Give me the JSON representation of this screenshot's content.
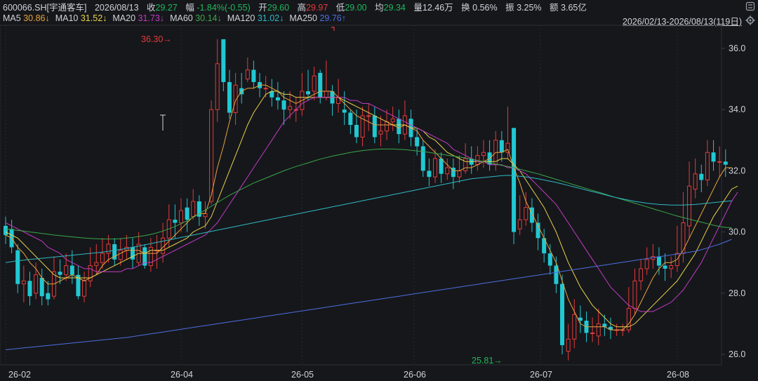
{
  "quote": {
    "symbol": "600066.SH[宇通客车]",
    "date": "2026/08/13",
    "close_label": "收",
    "close": "29.27",
    "change_label": "幅",
    "change": "-1.84%(-0.55)",
    "open_label": "开",
    "open": "29.60",
    "high_label": "高",
    "high": "29.97",
    "low_label": "低",
    "low": "29.00",
    "avg_label": "均",
    "avg": "29.34",
    "volume_label": "量",
    "volume": "12.46万",
    "turnover_label": "换",
    "turnover": "0.56%",
    "amplitude_label": "振",
    "amplitude": "3.25%",
    "amount_label": "额",
    "amount": "3.65亿"
  },
  "range_label": "2026/02/13-2026/08/13(119日)",
  "colors": {
    "background": "#16171b",
    "up": "#e23b3b",
    "down": "#21c8d2",
    "grid": "#262a31",
    "text": "#cfd3da",
    "green_text": "#1fb85a",
    "red_text": "#e23b3b"
  },
  "chart_data": {
    "type": "candlestick",
    "x_ticks": [
      "26-02",
      "26-04",
      "26-05",
      "26-06",
      "26-07",
      "26-08"
    ],
    "y_ticks": [
      "26.0",
      "28.0",
      "30.0",
      "32.0",
      "34.0",
      "36.0"
    ],
    "ylim": [
      25.6,
      36.7
    ],
    "max_marker": {
      "label": "36.30",
      "value": 36.3
    },
    "min_marker": {
      "label": "25.81",
      "value": 25.81
    },
    "ma_legend": [
      {
        "name": "MA5",
        "value": "30.86",
        "arrow": "↓",
        "color": "#e8a33c"
      },
      {
        "name": "MA10",
        "value": "31.52",
        "arrow": "↓",
        "color": "#e6d24a"
      },
      {
        "name": "MA20",
        "value": "31.73",
        "arrow": "↓",
        "color": "#c13cc3"
      },
      {
        "name": "MA60",
        "value": "30.14",
        "arrow": "↓",
        "color": "#3aa64a"
      },
      {
        "name": "MA120",
        "value": "31.02",
        "arrow": "↓",
        "color": "#2fb8c4"
      },
      {
        "name": "MA250",
        "value": "29.76",
        "arrow": "↑",
        "color": "#4a6fe0"
      }
    ],
    "candles": [
      [
        30.2,
        29.9,
        30.5,
        29.6
      ],
      [
        30.1,
        29.5,
        30.4,
        29.3
      ],
      [
        29.4,
        28.3,
        29.6,
        28.0
      ],
      [
        28.3,
        28.4,
        28.9,
        27.7
      ],
      [
        28.4,
        27.9,
        28.7,
        27.6
      ],
      [
        28.0,
        28.6,
        29.0,
        27.8
      ],
      [
        28.5,
        27.9,
        28.8,
        27.6
      ],
      [
        28.0,
        27.8,
        28.4,
        27.6
      ],
      [
        27.9,
        28.7,
        29.2,
        27.8
      ],
      [
        28.7,
        28.6,
        29.1,
        28.3
      ],
      [
        28.6,
        28.9,
        29.3,
        28.4
      ],
      [
        28.9,
        28.6,
        29.4,
        28.3
      ],
      [
        28.6,
        27.9,
        28.9,
        27.8
      ],
      [
        27.9,
        28.4,
        28.7,
        27.7
      ],
      [
        28.4,
        28.9,
        29.5,
        28.2
      ],
      [
        28.9,
        29.0,
        29.6,
        28.6
      ],
      [
        29.0,
        29.3,
        29.8,
        28.8
      ],
      [
        29.3,
        29.6,
        29.9,
        29.0
      ],
      [
        29.6,
        29.1,
        29.8,
        28.9
      ],
      [
        29.1,
        29.4,
        29.8,
        28.9
      ],
      [
        29.4,
        29.5,
        29.9,
        29.1
      ],
      [
        29.5,
        29.1,
        29.8,
        28.8
      ],
      [
        29.0,
        29.6,
        30.0,
        28.9
      ],
      [
        29.5,
        28.9,
        29.6,
        28.8
      ],
      [
        28.9,
        29.5,
        29.8,
        28.7
      ],
      [
        29.4,
        29.4,
        29.9,
        28.8
      ],
      [
        29.3,
        29.8,
        30.3,
        29.0
      ],
      [
        29.8,
        30.4,
        30.9,
        29.5
      ],
      [
        30.4,
        30.3,
        30.9,
        29.8
      ],
      [
        30.3,
        30.7,
        31.1,
        30.0
      ],
      [
        30.8,
        30.4,
        31.1,
        30.0
      ],
      [
        30.5,
        31.0,
        31.4,
        30.4
      ],
      [
        31.0,
        30.5,
        31.2,
        30.2
      ],
      [
        30.5,
        30.6,
        31.0,
        30.1
      ],
      [
        31.0,
        34.0,
        34.3,
        30.9
      ],
      [
        34.0,
        35.5,
        36.3,
        33.6
      ],
      [
        36.3,
        34.9,
        36.3,
        34.6
      ],
      [
        34.9,
        33.9,
        35.3,
        33.7
      ],
      [
        33.9,
        34.8,
        35.2,
        33.5
      ],
      [
        34.7,
        34.5,
        35.2,
        34.2
      ],
      [
        35.0,
        35.3,
        35.7,
        34.9
      ],
      [
        35.3,
        34.9,
        35.6,
        34.7
      ],
      [
        34.9,
        34.7,
        35.2,
        34.4
      ],
      [
        34.7,
        34.7,
        35.1,
        34.4
      ],
      [
        34.6,
        34.4,
        35.0,
        34.1
      ],
      [
        34.4,
        34.3,
        34.9,
        34.0
      ],
      [
        34.3,
        34.0,
        34.6,
        33.5
      ],
      [
        34.0,
        34.1,
        34.6,
        33.7
      ],
      [
        34.0,
        34.0,
        34.4,
        33.6
      ],
      [
        34.0,
        34.6,
        35.2,
        33.8
      ],
      [
        34.6,
        34.5,
        35.3,
        34.3
      ],
      [
        34.6,
        35.1,
        35.4,
        34.3
      ],
      [
        35.2,
        34.4,
        35.3,
        34.2
      ],
      [
        34.4,
        34.6,
        35.6,
        34.3
      ],
      [
        34.6,
        34.2,
        34.8,
        33.8
      ],
      [
        34.2,
        34.4,
        35.0,
        33.9
      ],
      [
        34.0,
        33.9,
        34.6,
        33.5
      ],
      [
        33.9,
        33.5,
        34.0,
        33.2
      ],
      [
        33.5,
        33.1,
        34.0,
        32.9
      ],
      [
        33.1,
        33.8,
        34.1,
        32.8
      ],
      [
        33.8,
        33.8,
        34.2,
        33.3
      ],
      [
        33.8,
        33.1,
        34.1,
        32.9
      ],
      [
        33.2,
        33.3,
        33.8,
        32.8
      ],
      [
        33.3,
        33.6,
        34.0,
        33.0
      ],
      [
        33.6,
        33.7,
        34.1,
        33.3
      ],
      [
        33.7,
        33.2,
        34.0,
        32.9
      ],
      [
        33.2,
        33.8,
        34.3,
        33.0
      ],
      [
        33.7,
        33.1,
        34.0,
        32.8
      ],
      [
        33.1,
        32.8,
        33.4,
        32.5
      ],
      [
        32.8,
        32.0,
        33.0,
        31.8
      ],
      [
        32.0,
        31.8,
        32.4,
        31.5
      ],
      [
        31.8,
        32.4,
        32.7,
        31.6
      ],
      [
        32.4,
        31.9,
        32.6,
        31.6
      ],
      [
        31.9,
        32.1,
        32.4,
        31.7
      ],
      [
        32.1,
        31.8,
        32.4,
        31.4
      ],
      [
        31.8,
        32.0,
        32.5,
        31.6
      ],
      [
        32.0,
        32.4,
        32.9,
        31.9
      ],
      [
        32.4,
        32.2,
        32.8,
        31.9
      ],
      [
        32.2,
        32.5,
        32.8,
        32.0
      ],
      [
        32.5,
        32.6,
        33.0,
        32.1
      ],
      [
        32.6,
        32.2,
        33.0,
        32.0
      ],
      [
        32.2,
        33.0,
        33.3,
        32.0
      ],
      [
        33.0,
        32.6,
        33.3,
        32.3
      ],
      [
        32.6,
        32.9,
        34.1,
        32.4
      ],
      [
        33.4,
        30.0,
        33.4,
        29.6
      ],
      [
        30.1,
        30.4,
        31.2,
        29.9
      ],
      [
        30.4,
        30.8,
        31.3,
        30.2
      ],
      [
        30.8,
        30.3,
        31.1,
        30.0
      ],
      [
        30.3,
        29.8,
        30.6,
        29.4
      ],
      [
        29.8,
        29.3,
        30.1,
        29.0
      ],
      [
        29.3,
        28.9,
        29.6,
        28.6
      ],
      [
        28.9,
        28.3,
        29.2,
        28.0
      ],
      [
        28.3,
        26.3,
        28.6,
        26.0
      ],
      [
        26.1,
        26.5,
        27.0,
        25.8
      ],
      [
        26.5,
        27.3,
        27.8,
        26.2
      ],
      [
        27.2,
        27.1,
        27.6,
        26.7
      ],
      [
        27.1,
        26.7,
        27.4,
        26.4
      ],
      [
        26.7,
        26.7,
        27.2,
        26.4
      ],
      [
        26.6,
        27.0,
        27.5,
        26.3
      ],
      [
        27.0,
        26.9,
        27.3,
        26.6
      ],
      [
        26.9,
        26.8,
        27.2,
        26.5
      ],
      [
        26.8,
        26.8,
        27.0,
        26.6
      ],
      [
        26.8,
        26.8,
        27.0,
        26.6
      ],
      [
        26.8,
        27.5,
        28.2,
        26.7
      ],
      [
        27.5,
        28.4,
        28.8,
        27.3
      ],
      [
        28.4,
        28.8,
        29.1,
        28.1
      ],
      [
        28.8,
        29.1,
        29.5,
        28.6
      ],
      [
        29.1,
        29.2,
        29.6,
        28.8
      ],
      [
        29.2,
        28.9,
        29.5,
        28.6
      ],
      [
        28.9,
        28.8,
        29.3,
        28.4
      ],
      [
        28.8,
        28.9,
        29.2,
        28.5
      ],
      [
        28.9,
        29.3,
        30.2,
        28.7
      ],
      [
        29.3,
        30.3,
        31.3,
        29.0
      ],
      [
        30.2,
        31.5,
        32.3,
        29.8
      ],
      [
        31.4,
        31.9,
        32.4,
        31.1
      ],
      [
        31.9,
        31.7,
        32.2,
        31.3
      ],
      [
        31.7,
        32.6,
        33.0,
        31.5
      ],
      [
        32.6,
        32.3,
        33.0,
        32.0
      ],
      [
        32.3,
        32.3,
        32.8,
        31.8
      ],
      [
        32.3,
        32.2,
        32.7,
        31.8
      ]
    ],
    "ma5": [
      29.9,
      29.8,
      29.5,
      29.3,
      29.0,
      28.8,
      28.5,
      28.3,
      28.3,
      28.4,
      28.5,
      28.6,
      28.5,
      28.4,
      28.5,
      28.6,
      28.9,
      29.1,
      29.2,
      29.3,
      29.4,
      29.4,
      29.4,
      29.3,
      29.3,
      29.3,
      29.5,
      29.7,
      29.9,
      30.1,
      30.3,
      30.5,
      30.6,
      30.6,
      31.2,
      32.1,
      32.8,
      33.6,
      34.3,
      34.6,
      34.7,
      34.7,
      34.8,
      34.8,
      34.7,
      34.6,
      34.4,
      34.3,
      34.2,
      34.3,
      34.4,
      34.5,
      34.6,
      34.6,
      34.6,
      34.4,
      34.2,
      34.0,
      33.8,
      33.7,
      33.6,
      33.5,
      33.5,
      33.5,
      33.5,
      33.4,
      33.5,
      33.4,
      33.3,
      33.0,
      32.8,
      32.6,
      32.4,
      32.2,
      32.0,
      32.0,
      32.1,
      32.1,
      32.2,
      32.3,
      32.4,
      32.6,
      32.6,
      32.7,
      32.1,
      31.6,
      31.0,
      30.6,
      30.2,
      29.8,
      29.4,
      29.0,
      28.4,
      27.8,
      27.4,
      27.0,
      26.9,
      26.9,
      26.9,
      26.9,
      26.8,
      26.8,
      26.8,
      27.0,
      27.3,
      27.7,
      28.1,
      28.5,
      28.8,
      29.0,
      29.0,
      29.1,
      29.4,
      29.8,
      30.2,
      30.6,
      31.0,
      31.4,
      31.8,
      32.1,
      32.1
    ],
    "ma10": [
      30.0,
      29.9,
      29.8,
      29.6,
      29.4,
      29.2,
      29.0,
      28.8,
      28.6,
      28.5,
      28.5,
      28.5,
      28.5,
      28.5,
      28.5,
      28.6,
      28.7,
      28.8,
      28.9,
      29.0,
      29.1,
      29.2,
      29.3,
      29.3,
      29.4,
      29.4,
      29.4,
      29.5,
      29.6,
      29.7,
      29.8,
      30.0,
      30.1,
      30.2,
      30.5,
      31.0,
      31.5,
      32.0,
      32.5,
      33.0,
      33.5,
      33.9,
      34.2,
      34.5,
      34.6,
      34.6,
      34.5,
      34.5,
      34.4,
      34.4,
      34.4,
      34.4,
      34.4,
      34.4,
      34.4,
      34.4,
      34.3,
      34.2,
      34.1,
      34.0,
      33.9,
      33.8,
      33.7,
      33.6,
      33.5,
      33.5,
      33.5,
      33.4,
      33.4,
      33.3,
      33.1,
      33.0,
      32.8,
      32.6,
      32.5,
      32.4,
      32.3,
      32.3,
      32.3,
      32.3,
      32.3,
      32.3,
      32.4,
      32.4,
      32.2,
      32.0,
      31.7,
      31.4,
      31.1,
      30.8,
      30.4,
      30.0,
      29.5,
      29.0,
      28.6,
      28.2,
      27.9,
      27.6,
      27.4,
      27.2,
      27.0,
      26.9,
      26.9,
      26.9,
      27.0,
      27.2,
      27.4,
      27.6,
      27.8,
      28.0,
      28.2,
      28.4,
      28.7,
      29.0,
      29.3,
      29.7,
      30.1,
      30.5,
      30.8,
      31.1,
      31.4,
      31.5
    ],
    "ma20": [
      30.3,
      30.2,
      30.1,
      30.0,
      29.9,
      29.8,
      29.7,
      29.5,
      29.4,
      29.3,
      29.1,
      29.0,
      28.9,
      28.8,
      28.8,
      28.7,
      28.7,
      28.7,
      28.7,
      28.7,
      28.8,
      28.8,
      28.9,
      29.0,
      29.0,
      29.1,
      29.2,
      29.3,
      29.4,
      29.5,
      29.6,
      29.7,
      29.8,
      29.9,
      30.1,
      30.3,
      30.6,
      30.9,
      31.2,
      31.5,
      31.8,
      32.1,
      32.4,
      32.7,
      33.0,
      33.3,
      33.6,
      33.8,
      34.0,
      34.2,
      34.3,
      34.4,
      34.4,
      34.4,
      34.4,
      34.4,
      34.4,
      34.3,
      34.3,
      34.2,
      34.2,
      34.1,
      34.0,
      33.9,
      33.8,
      33.7,
      33.6,
      33.5,
      33.4,
      33.3,
      33.2,
      33.1,
      33.0,
      32.9,
      32.7,
      32.6,
      32.5,
      32.4,
      32.3,
      32.3,
      32.2,
      32.2,
      32.2,
      32.1,
      32.1,
      32.0,
      31.9,
      31.7,
      31.5,
      31.3,
      31.1,
      30.9,
      30.6,
      30.3,
      30.0,
      29.7,
      29.4,
      29.1,
      28.8,
      28.5,
      28.2,
      28.0,
      27.8,
      27.6,
      27.5,
      27.4,
      27.4,
      27.4,
      27.5,
      27.6,
      27.7,
      27.9,
      28.1,
      28.4,
      28.7,
      29.0,
      29.4,
      29.8,
      30.2,
      30.6,
      31.0,
      31.3
    ],
    "ma60": [
      30.1,
      30.08,
      30.05,
      30.03,
      30.0,
      29.98,
      29.95,
      29.93,
      29.9,
      29.88,
      29.86,
      29.84,
      29.82,
      29.8,
      29.79,
      29.78,
      29.77,
      29.77,
      29.77,
      29.78,
      29.8,
      29.82,
      29.85,
      29.88,
      29.92,
      29.97,
      30.03,
      30.1,
      30.18,
      30.27,
      30.37,
      30.48,
      30.6,
      30.72,
      30.84,
      30.96,
      31.08,
      31.2,
      31.3,
      31.4,
      31.5,
      31.6,
      31.68,
      31.76,
      31.84,
      31.92,
      32.0,
      32.07,
      32.14,
      32.2,
      32.26,
      32.32,
      32.38,
      32.43,
      32.48,
      32.52,
      32.56,
      32.6,
      32.63,
      32.66,
      32.68,
      32.7,
      32.71,
      32.71,
      32.71,
      32.7,
      32.69,
      32.67,
      32.65,
      32.63,
      32.6,
      32.57,
      32.54,
      32.51,
      32.48,
      32.45,
      32.42,
      32.38,
      32.34,
      32.3,
      32.26,
      32.22,
      32.18,
      32.14,
      32.1,
      32.05,
      32.0,
      31.95,
      31.9,
      31.84,
      31.78,
      31.72,
      31.66,
      31.6,
      31.54,
      31.48,
      31.42,
      31.36,
      31.3,
      31.24,
      31.18,
      31.12,
      31.06,
      31.0,
      30.94,
      30.88,
      30.82,
      30.76,
      30.7,
      30.64,
      30.58,
      30.52,
      30.47,
      30.42,
      30.37,
      30.32,
      30.27,
      30.22,
      30.18,
      30.15,
      30.14
    ],
    "ma120": [
      29.0,
      29.03,
      29.06,
      29.08,
      29.1,
      29.12,
      29.14,
      29.16,
      29.18,
      29.2,
      29.22,
      29.24,
      29.26,
      29.28,
      29.3,
      29.32,
      29.34,
      29.37,
      29.4,
      29.43,
      29.46,
      29.5,
      29.54,
      29.58,
      29.62,
      29.66,
      29.7,
      29.74,
      29.78,
      29.82,
      29.86,
      29.9,
      29.94,
      29.98,
      30.02,
      30.06,
      30.1,
      30.14,
      30.18,
      30.22,
      30.26,
      30.3,
      30.34,
      30.38,
      30.42,
      30.46,
      30.5,
      30.54,
      30.58,
      30.62,
      30.66,
      30.7,
      30.74,
      30.78,
      30.82,
      30.86,
      30.9,
      30.94,
      30.98,
      31.02,
      31.06,
      31.1,
      31.14,
      31.18,
      31.22,
      31.26,
      31.3,
      31.34,
      31.38,
      31.42,
      31.46,
      31.5,
      31.54,
      31.58,
      31.62,
      31.66,
      31.7,
      31.74,
      31.76,
      31.78,
      31.8,
      31.82,
      31.84,
      31.85,
      31.84,
      31.82,
      31.8,
      31.77,
      31.74,
      31.7,
      31.66,
      31.62,
      31.57,
      31.52,
      31.47,
      31.42,
      31.37,
      31.32,
      31.27,
      31.22,
      31.17,
      31.12,
      31.08,
      31.04,
      31.0,
      30.97,
      30.94,
      30.92,
      30.9,
      30.89,
      30.88,
      30.88,
      30.88,
      30.89,
      30.9,
      30.92,
      30.94,
      30.96,
      30.98,
      31.0,
      31.02
    ],
    "ma250": [
      26.15,
      26.17,
      26.19,
      26.21,
      26.23,
      26.25,
      26.27,
      26.29,
      26.31,
      26.33,
      26.35,
      26.37,
      26.39,
      26.41,
      26.43,
      26.45,
      26.47,
      26.49,
      26.51,
      26.53,
      26.55,
      26.58,
      26.61,
      26.64,
      26.67,
      26.7,
      26.73,
      26.76,
      26.79,
      26.82,
      26.85,
      26.88,
      26.91,
      26.94,
      26.97,
      27.0,
      27.03,
      27.06,
      27.09,
      27.12,
      27.15,
      27.18,
      27.21,
      27.24,
      27.27,
      27.3,
      27.33,
      27.36,
      27.39,
      27.42,
      27.45,
      27.48,
      27.51,
      27.54,
      27.57,
      27.6,
      27.63,
      27.66,
      27.69,
      27.72,
      27.75,
      27.78,
      27.81,
      27.84,
      27.87,
      27.9,
      27.93,
      27.96,
      27.99,
      28.02,
      28.05,
      28.08,
      28.11,
      28.14,
      28.17,
      28.2,
      28.23,
      28.26,
      28.29,
      28.32,
      28.35,
      28.38,
      28.41,
      28.44,
      28.47,
      28.5,
      28.53,
      28.56,
      28.59,
      28.62,
      28.65,
      28.68,
      28.71,
      28.74,
      28.77,
      28.8,
      28.83,
      28.86,
      28.89,
      28.92,
      28.95,
      28.98,
      29.01,
      29.04,
      29.07,
      29.1,
      29.13,
      29.16,
      29.19,
      29.22,
      29.25,
      29.28,
      29.31,
      29.34,
      29.37,
      29.42,
      29.48,
      29.54,
      29.6,
      29.68,
      29.76
    ]
  }
}
